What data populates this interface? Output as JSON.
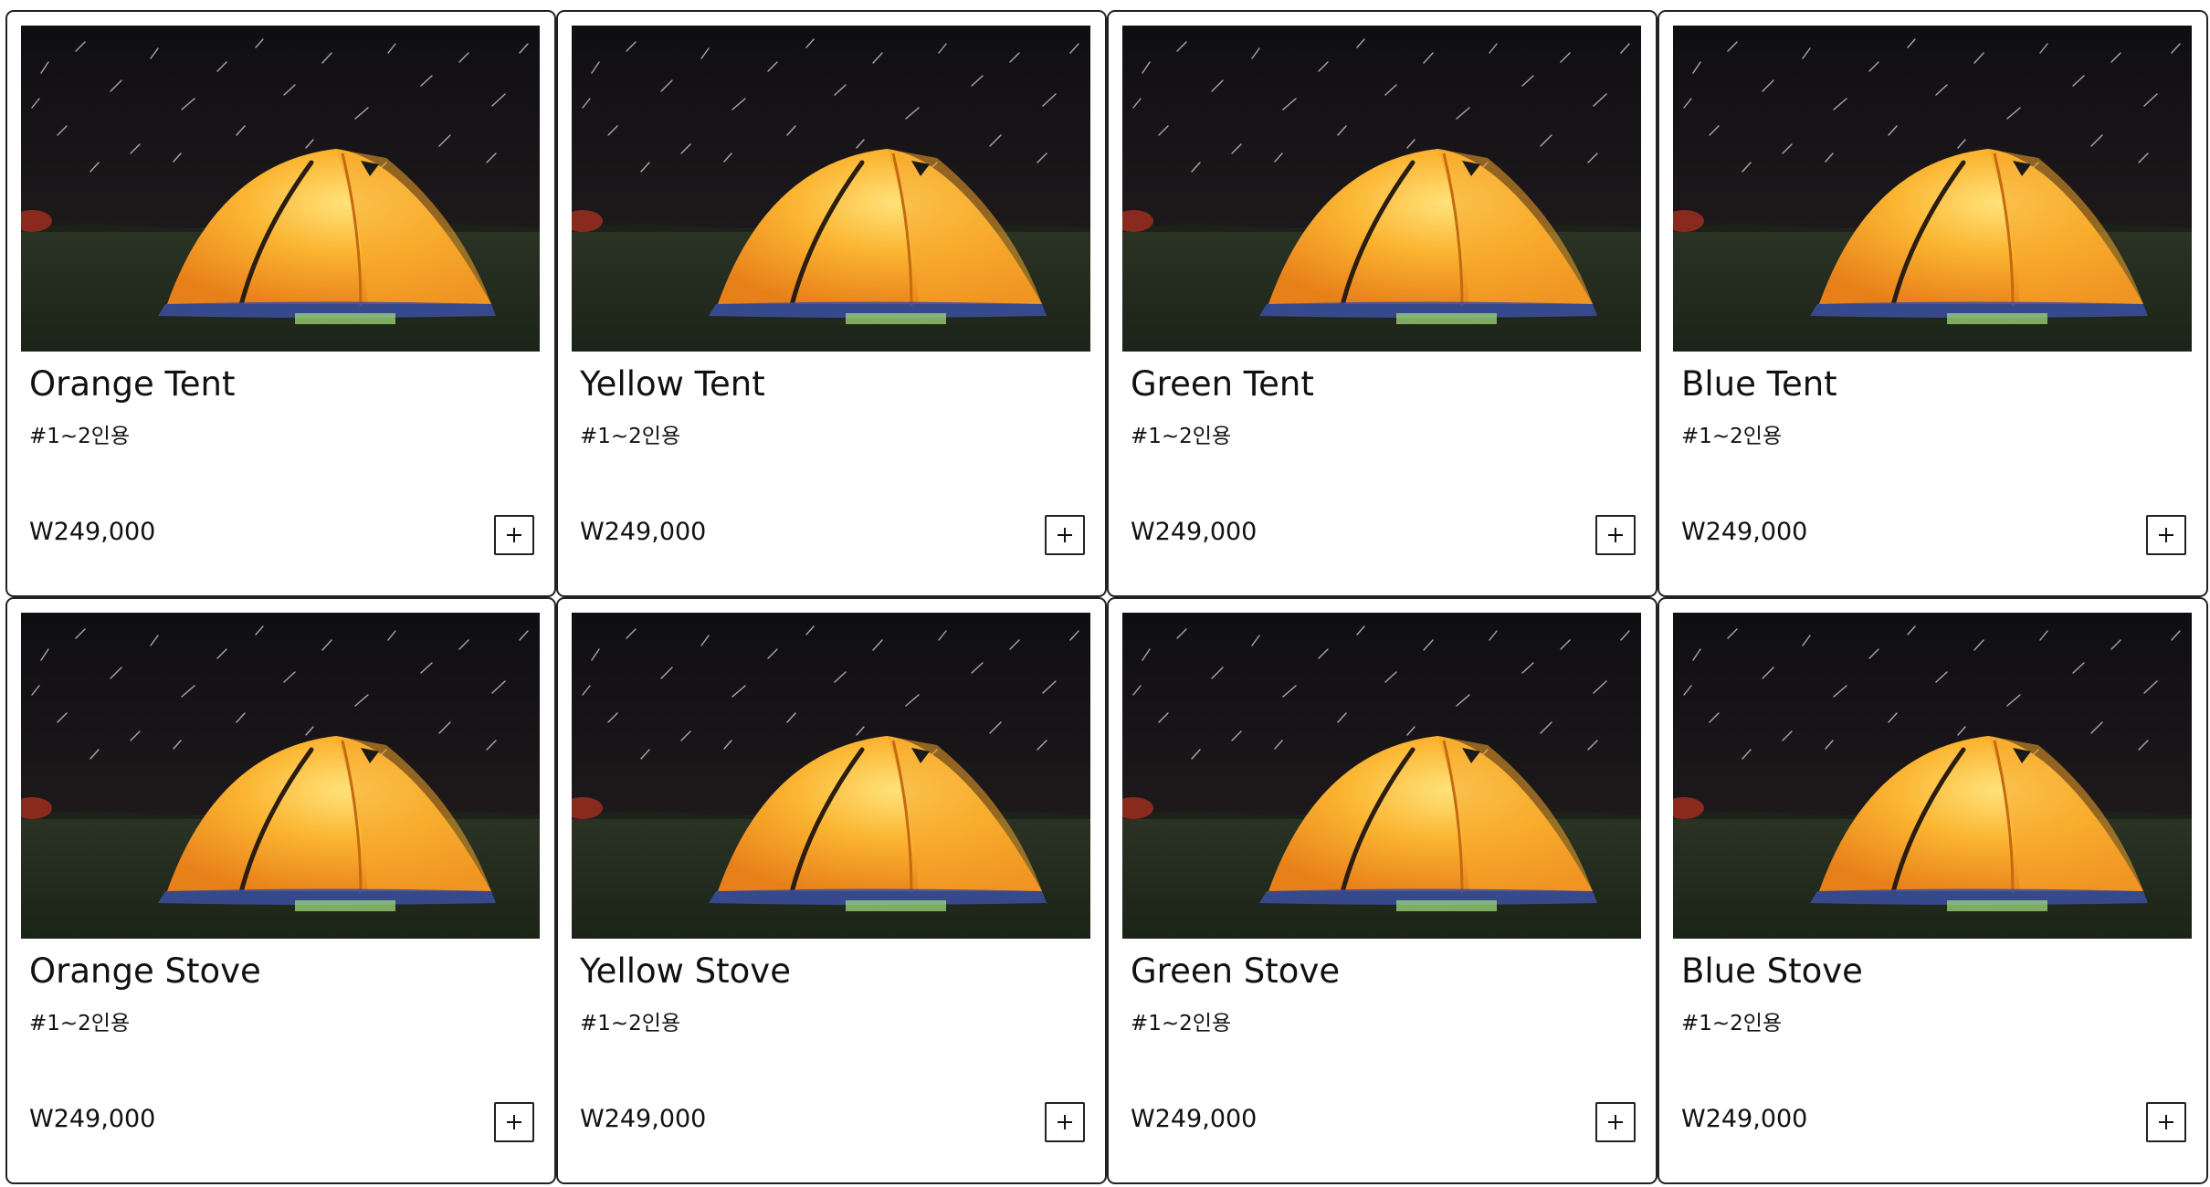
{
  "products": [
    {
      "name": "Orange Tent",
      "tag": "#1~2인용",
      "price": "W249,000"
    },
    {
      "name": "Yellow Tent",
      "tag": "#1~2인용",
      "price": "W249,000"
    },
    {
      "name": "Green Tent",
      "tag": "#1~2인용",
      "price": "W249,000"
    },
    {
      "name": "Blue Tent",
      "tag": "#1~2인용",
      "price": "W249,000"
    },
    {
      "name": "Orange Stove",
      "tag": "#1~2인용",
      "price": "W249,000"
    },
    {
      "name": "Yellow Stove",
      "tag": "#1~2인용",
      "price": "W249,000"
    },
    {
      "name": "Green Stove",
      "tag": "#1~2인용",
      "price": "W249,000"
    },
    {
      "name": "Blue Stove",
      "tag": "#1~2인용",
      "price": "W249,000"
    }
  ],
  "add_button_icon": "plus-icon",
  "colors": {
    "text": "#111111",
    "border": "#222222",
    "tent": "#f5a623",
    "night_sky": "#141316"
  }
}
